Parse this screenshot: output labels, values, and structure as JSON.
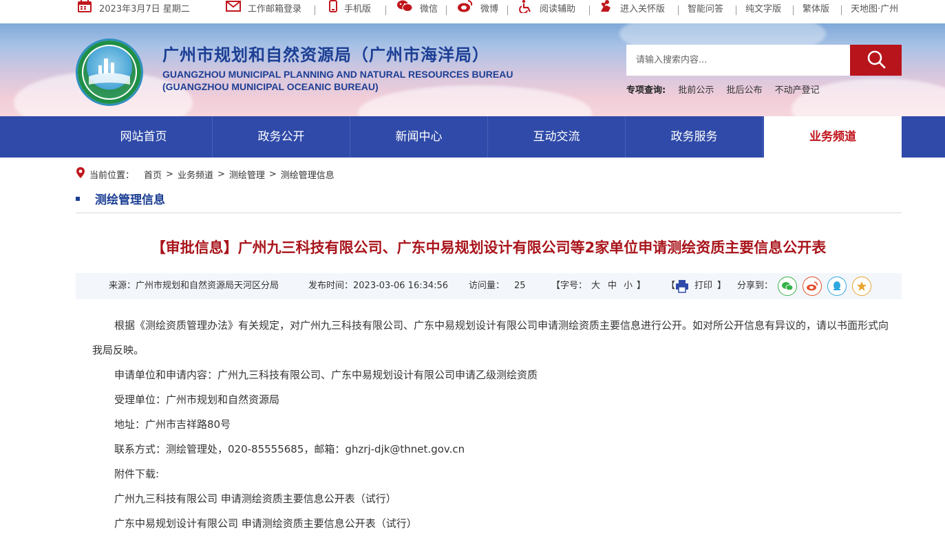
{
  "topbar": {
    "date": "2023年3月7日 星期二",
    "links": [
      "工作邮箱登录",
      "手机版",
      "微信",
      "微博",
      "阅读辅助",
      "进入关怀版",
      "智能问答",
      "纯文字版",
      "繁体版",
      "天地图·广州"
    ]
  },
  "header": {
    "title_cn": "广州市规划和自然资源局（广州市海洋局）",
    "title_en_1": "GUANGZHOU MUNICIPAL PLANNING AND NATURAL RESOURCES BUREAU",
    "title_en_2": "(GUANGZHOU MUNICIPAL OCEANIC BUREAU)",
    "search_placeholder": "请输入搜索内容...",
    "special_label": "专项查询:",
    "special_links": [
      "批前公示",
      "批后公布",
      "不动产登记"
    ]
  },
  "nav": {
    "tabs": [
      "网站首页",
      "政务公开",
      "新闻中心",
      "互动交流",
      "政务服务",
      "业务频道"
    ],
    "active_index": 5
  },
  "breadcrumb": {
    "label": "当前位置：",
    "items": [
      "首页",
      "业务频道",
      "测绘管理",
      "测绘管理信息"
    ]
  },
  "section_title": "测绘管理信息",
  "article": {
    "title": "【审批信息】广州九三科技有限公司、广东中易规划设计有限公司等2家单位申请测绘资质主要信息公开表",
    "source": "来源：广州市规划和自然资源局天河区分局",
    "publish_time": "发布时间：2023-03-06 16:34:56",
    "visits_label": "访问量：",
    "visits": "25",
    "font_label": "【字号：",
    "font_sizes": [
      "大",
      "中",
      "小"
    ],
    "font_end": "】",
    "print_open": "【",
    "print_label": "打印",
    "print_close": "】",
    "share_label": "分享到：",
    "paragraphs": [
      "根据《测绘资质管理办法》有关规定，对广州九三科技有限公司、广东中易规划设计有限公司申请测绘资质主要信息进行公开。如对所公开信息有异议的，请以书面形式向我局反映。",
      "申请单位和申请内容：广州九三科技有限公司、广东中易规划设计有限公司申请乙级测绘资质",
      "受理单位：广州市规划和自然资源局",
      "地址：广州市吉祥路80号",
      "联系方式：测绘管理处，020-85555685，邮箱：ghzrj-djk@thnet.gov.cn",
      "附件下载:",
      "广州九三科技有限公司 申请测绘资质主要信息公开表（试行）",
      "广东中易规划设计有限公司 申请测绘资质主要信息公开表（试行）"
    ]
  },
  "colors": {
    "brand_blue": "#2f4aa8",
    "title_blue": "#1c3f94",
    "accent_red": "#b8141b"
  }
}
